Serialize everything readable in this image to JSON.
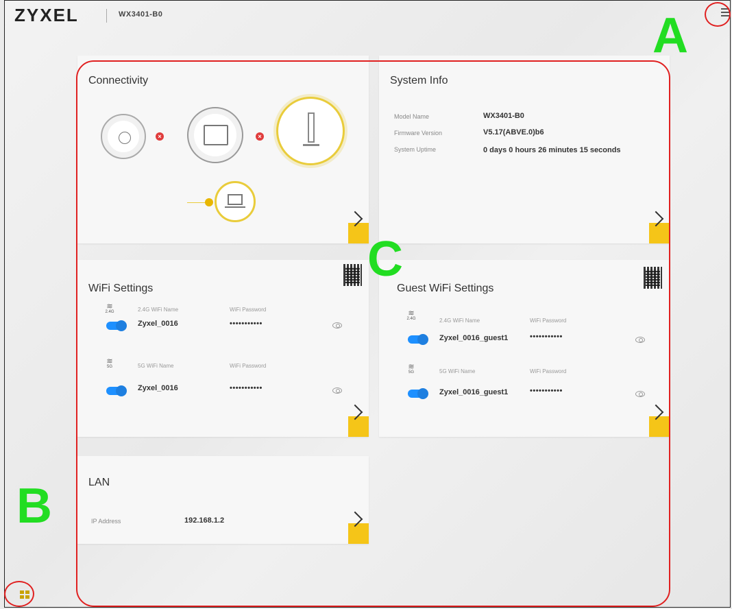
{
  "header": {
    "logo": "ZYXEL",
    "model": "WX3401-B0"
  },
  "callouts": {
    "a": "A",
    "b": "B",
    "c": "C"
  },
  "colors": {
    "accent": "#f5c518",
    "callout_text": "#22dd22",
    "callout_outline": "#e02020",
    "toggle_on": "#1e90ff"
  },
  "connectivity": {
    "title": "Connectivity",
    "icons": [
      "globe-icon",
      "router-icon",
      "access-point-icon",
      "laptop-icon"
    ]
  },
  "system_info": {
    "title": "System Info",
    "rows": [
      {
        "label": "Model Name",
        "value": "WX3401-B0"
      },
      {
        "label": "Firmware Version",
        "value": "V5.17(ABVE.0)b6"
      },
      {
        "label": "System Uptime",
        "value": "0 days 0 hours 26 minutes 15 seconds"
      }
    ]
  },
  "wifi_settings": {
    "title": "WiFi Settings",
    "bands": [
      {
        "band": "2.4G",
        "name_label": "2.4G WiFi Name",
        "name": "Zyxel_0016",
        "pw_label": "WiFi Password",
        "password": "•••••••••••"
      },
      {
        "band": "5G",
        "name_label": "5G WiFi Name",
        "name": "Zyxel_0016",
        "pw_label": "WiFi Password",
        "password": "•••••••••••"
      }
    ]
  },
  "guest_wifi": {
    "title": "Guest WiFi Settings",
    "bands": [
      {
        "band": "2.4G",
        "name_label": "2.4G WiFi Name",
        "name": "Zyxel_0016_guest1",
        "pw_label": "WiFi Password",
        "password": "•••••••••••"
      },
      {
        "band": "5G",
        "name_label": "5G WiFi Name",
        "name": "Zyxel_0016_guest1",
        "pw_label": "WiFi Password",
        "password": "•••••••••••"
      }
    ]
  },
  "lan": {
    "title": "LAN",
    "ip_label": "IP Address",
    "ip": "192.168.1.2"
  }
}
